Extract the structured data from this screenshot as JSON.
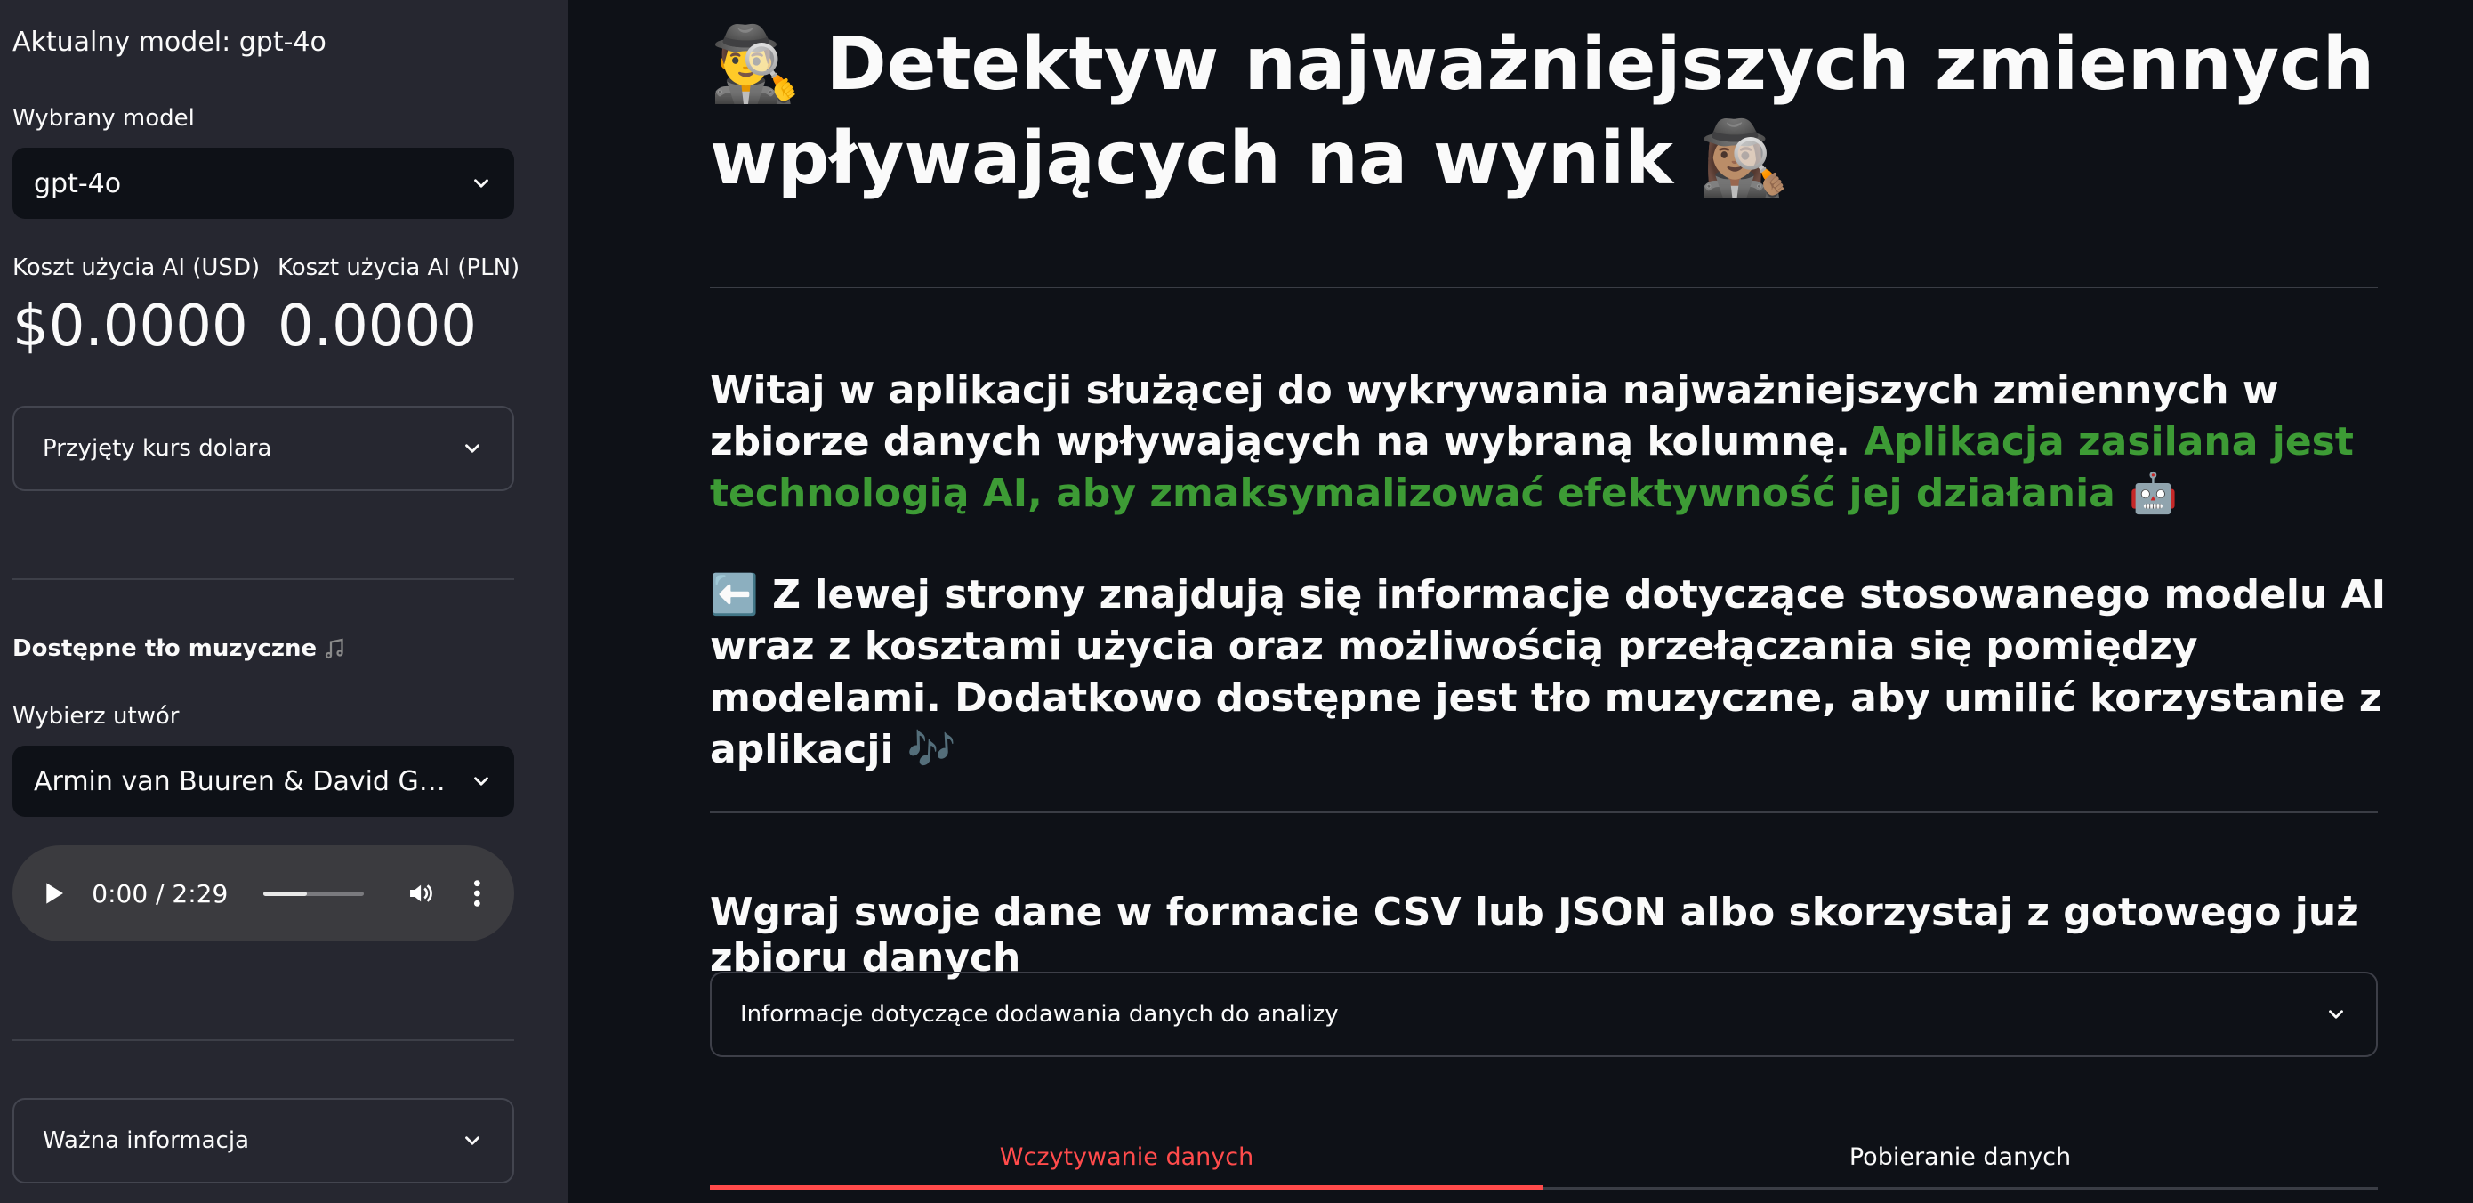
{
  "sidebar": {
    "current_model": "Aktualny model: gpt-4o",
    "model_select": {
      "label": "Wybrany model",
      "value": "gpt-4o"
    },
    "cost_usd": {
      "label": "Koszt użycia AI (USD)",
      "value": "$0.0000"
    },
    "cost_pln": {
      "label": "Koszt użycia AI (PLN)",
      "value": "0.0000"
    },
    "rate_expander": "Przyjęty kurs dolara",
    "music_section": {
      "title": "Dostępne tło muzyczne",
      "icon": "music-notes-icon"
    },
    "track_select": {
      "label": "Wybierz utwór",
      "value": "Armin van Buuren & David Guetta – Hey Now"
    },
    "audio": {
      "time": "0:00 / 2:29",
      "progress": 0.43
    },
    "info_expander": "Ważna informacja"
  },
  "main": {
    "title": "🕵️‍♂️ Detektyw najważniejszych zmiennych wpływających na wynik 🕵🏽‍♀️",
    "intro_text": "Witaj w aplikacji służącej do wykrywania najważniejszych zmiennych w zbiorze danych wpływających na wybraną kolumnę.",
    "intro_green": "Aplikacja zasilana jest technologią AI, aby zmaksymalizować efektywność jej działania 🤖",
    "intro2_icon": "⬅️",
    "intro2_text": "Z lewej strony znajdują się informacje dotyczące stosowanego modelu AI wraz z kosztami użycia oraz możliwością przełączania się pomiędzy modelami. Dodatkowo dostępne jest tło muzyczne, aby umilić korzystanie z aplikacji 🎶",
    "upload_heading": "Wgraj swoje dane w formacie CSV lub JSON albo skorzystaj z gotowego już zbioru danych",
    "info_expander": "Informacje dotyczące dodawania danych do analizy",
    "tabs": [
      {
        "label": "Wczytywanie danych",
        "active": true
      },
      {
        "label": "Pobieranie danych",
        "active": false
      }
    ]
  },
  "colors": {
    "accent": "#ff4b4b",
    "green_text": "#3d9b35",
    "sidebar_bg": "#262730",
    "main_bg": "#0e1117"
  }
}
